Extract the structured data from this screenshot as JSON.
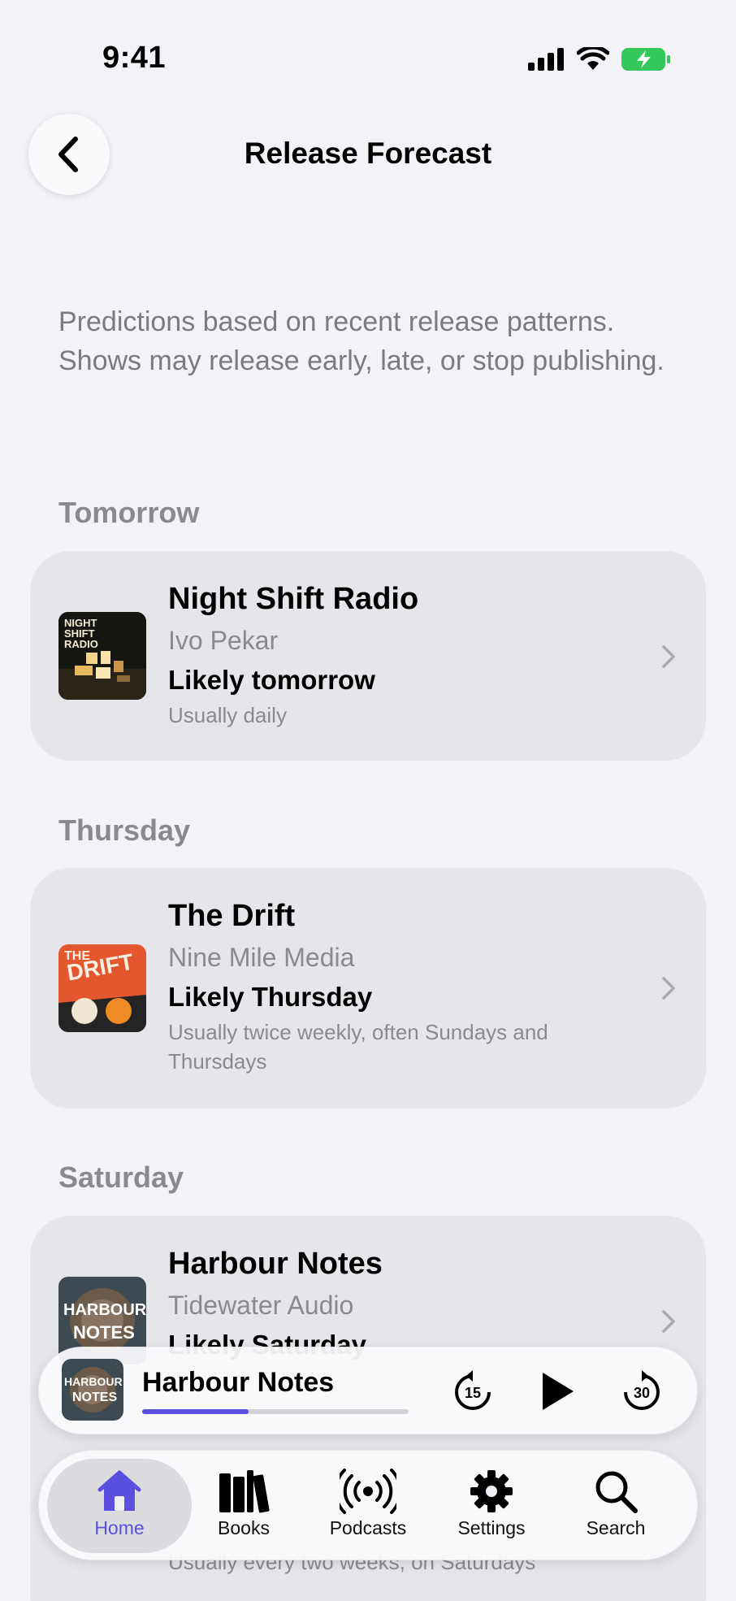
{
  "status": {
    "time": "9:41"
  },
  "header": {
    "title": "Release Forecast"
  },
  "intro": "Predictions based on recent release patterns. Shows may release early, late, or stop publishing.",
  "sections": [
    {
      "header": "Tomorrow",
      "show": {
        "title": "Night Shift Radio",
        "author": "Ivo Pekar",
        "likely": "Likely tomorrow",
        "note": "Usually daily",
        "art_text": "NIGHT SHIFT RADIO"
      }
    },
    {
      "header": "Thursday",
      "show": {
        "title": "The Drift",
        "author": "Nine Mile Media",
        "likely": "Likely Thursday",
        "note": "Usually twice weekly, often Sundays and Thursdays",
        "art_text_top": "THE",
        "art_text_main": "DRIFT"
      }
    },
    {
      "header": "Saturday",
      "show": {
        "title": "Harbour Notes",
        "author": "Tidewater Audio",
        "likely": "Likely Saturday",
        "note": "Usually every two weeks, on Saturdays",
        "art_text_1": "HARBOUR",
        "art_text_2": "NOTES"
      }
    }
  ],
  "player": {
    "title": "Harbour Notes",
    "progress": 0.4,
    "skip_back": "15",
    "skip_forward": "30"
  },
  "tabs": [
    {
      "label": "Home",
      "icon": "house-icon",
      "active": true
    },
    {
      "label": "Books",
      "icon": "books-icon",
      "active": false
    },
    {
      "label": "Podcasts",
      "icon": "broadcast-icon",
      "active": false
    },
    {
      "label": "Settings",
      "icon": "gear-icon",
      "active": false
    },
    {
      "label": "Search",
      "icon": "magnifier-icon",
      "active": false
    }
  ],
  "colors": {
    "accent": "#5b4fe0",
    "background": "#f2f2f7",
    "card": "#e5e5ea",
    "secondary_text": "#8a8a8e"
  }
}
